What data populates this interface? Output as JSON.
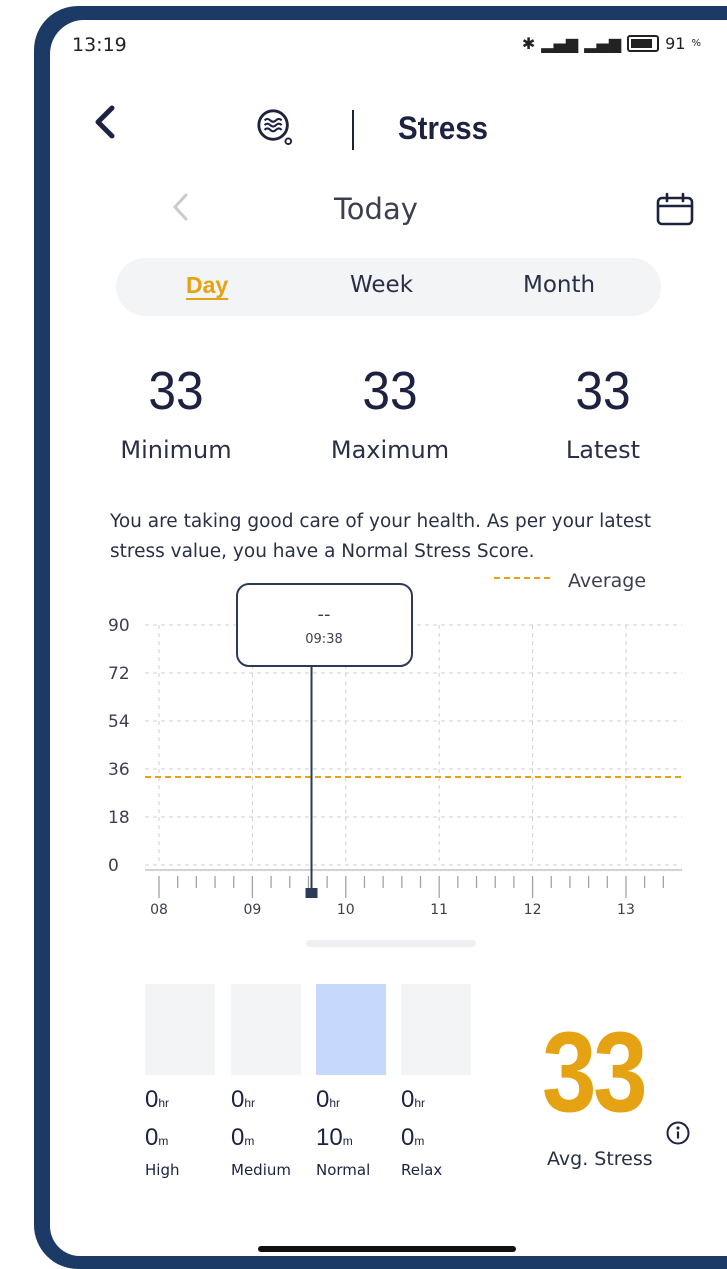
{
  "status": {
    "time": "13:19",
    "battery": "91",
    "battery_unit": "%"
  },
  "header": {
    "back_icon": "chevron-left-icon",
    "app_icon": "stress-wave-icon",
    "title": "Stress"
  },
  "date_nav": {
    "label": "Today",
    "prev_icon": "chevron-left-icon",
    "calendar_icon": "calendar-icon"
  },
  "tabs": [
    {
      "label": "Day",
      "active": true
    },
    {
      "label": "Week",
      "active": false
    },
    {
      "label": "Month",
      "active": false
    }
  ],
  "stats": [
    {
      "value": "33",
      "label": "Minimum"
    },
    {
      "value": "33",
      "label": "Maximum"
    },
    {
      "value": "33",
      "label": "Latest"
    }
  ],
  "message": "You are taking good care of your health. As per your latest stress value, you have a Normal Stress Score.",
  "legend": {
    "average_label": "Average",
    "average_color": "#e5a313"
  },
  "chart_data": {
    "type": "line",
    "y_ticks": [
      "0",
      "18",
      "36",
      "54",
      "72",
      "90"
    ],
    "ylim": [
      0,
      90
    ],
    "x_ticks": [
      "08",
      "09",
      "10",
      "11",
      "12",
      "13"
    ],
    "xlim": [
      7.85,
      13.6
    ],
    "average": 33,
    "grid": true,
    "series": [],
    "tooltip": {
      "value": "--",
      "time": "09:38",
      "x": 9.633
    }
  },
  "buckets": [
    {
      "hours": "0",
      "hr_unit": "hr",
      "minutes": "0",
      "min_unit": "m",
      "name": "High",
      "selected": false
    },
    {
      "hours": "0",
      "hr_unit": "hr",
      "minutes": "0",
      "min_unit": "m",
      "name": "Medium",
      "selected": false
    },
    {
      "hours": "0",
      "hr_unit": "hr",
      "minutes": "10",
      "min_unit": "m",
      "name": "Normal",
      "selected": true
    },
    {
      "hours": "0",
      "hr_unit": "hr",
      "minutes": "0",
      "min_unit": "m",
      "name": "Relax",
      "selected": false
    }
  ],
  "avg_stress": {
    "value": "33",
    "label": "Avg. Stress",
    "info_icon": "info-icon"
  },
  "colors": {
    "accent": "#e5a313",
    "navy": "#1d2240",
    "frame": "#1c3a66",
    "selected_bucket": "#c6d8fb"
  }
}
